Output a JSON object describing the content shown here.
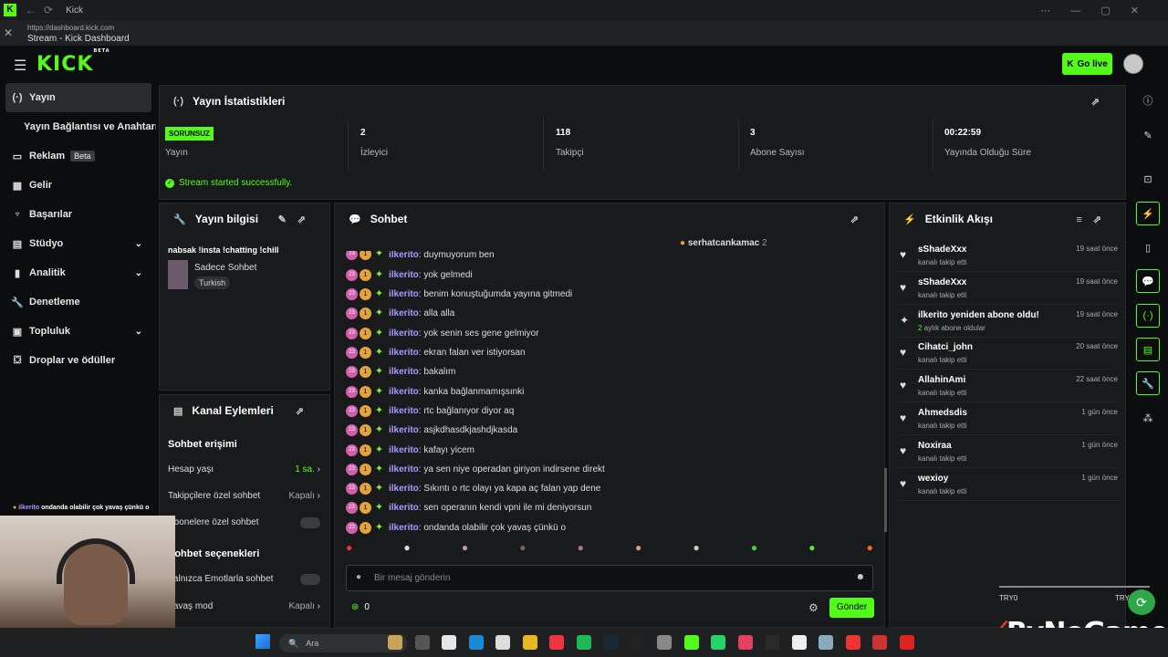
{
  "window": {
    "app_title": "Kick",
    "url": "https://dashboard.kick.com",
    "page_title": "Stream - Kick Dashboard"
  },
  "header": {
    "logo": "KICK",
    "logo_badge": "BETA",
    "go_live": "Go live"
  },
  "sidebar": {
    "items": [
      {
        "label": "Yayın",
        "icon": "broadcast-icon"
      },
      {
        "label": "Yayın Bağlantısı ve Anahtarı",
        "icon": ""
      },
      {
        "label": "Reklam",
        "icon": "ad-icon",
        "badge": "Beta"
      },
      {
        "label": "Gelir",
        "icon": "revenue-icon"
      },
      {
        "label": "Başarılar",
        "icon": "trophy-icon"
      },
      {
        "label": "Stüdyo",
        "icon": "studio-icon"
      },
      {
        "label": "Analitik",
        "icon": "analytics-icon"
      },
      {
        "label": "Denetleme",
        "icon": "wrench-icon"
      },
      {
        "label": "Topluluk",
        "icon": "community-icon"
      },
      {
        "label": "Droplar ve ödüller",
        "icon": "drops-icon"
      }
    ]
  },
  "stats": {
    "title": "Yayın İstatistikleri",
    "status_badge": "SORUNSUZ",
    "status_label": "Yayın",
    "items": [
      {
        "value": "2",
        "label": "İzleyici"
      },
      {
        "value": "118",
        "label": "Takipçi"
      },
      {
        "value": "3",
        "label": "Abone Sayısı"
      },
      {
        "value": "00:22:59",
        "label": "Yayında Olduğu Süre"
      }
    ],
    "success": "Stream started successfully."
  },
  "stream_info": {
    "title": "Yayın bilgisi",
    "stream_title": "nabsak !insta !chatting !chill",
    "category": "Sadece Sohbet",
    "language": "Turkish"
  },
  "channel_actions": {
    "title": "Kanal Eylemleri",
    "section1": "Sohbet erişimi",
    "account_age": "Hesap yaşı",
    "account_age_value": "1 sa.",
    "followers_chat": "Takipçilere özel sohbet",
    "followers_chat_value": "Kapalı",
    "subscribers_chat": "Abonelere özel sohbet",
    "section2": "Sohbet seçenekleri",
    "emote_only": "Yalnızca Emotlarla sohbet",
    "slow_mode": "Yavaş mod",
    "slow_mode_value": "Kapalı"
  },
  "chat": {
    "title": "Sohbet",
    "pinned_user": "serhatcankamac",
    "pinned_count": "2",
    "badge_number": "23",
    "badge_sub": "1",
    "messages": [
      {
        "user": "ilkerito",
        "text": "duymuyorum ben"
      },
      {
        "user": "ilkerito",
        "text": "yok gelmedi"
      },
      {
        "user": "ilkerito",
        "text": "benim konuştuğumda yayına gitmedi"
      },
      {
        "user": "ilkerito",
        "text": "alla alla"
      },
      {
        "user": "ilkerito",
        "text": "yok senin ses gene gelmiyor"
      },
      {
        "user": "ilkerito",
        "text": "ekran falan ver istiyorsan"
      },
      {
        "user": "ilkerito",
        "text": "bakalım"
      },
      {
        "user": "ilkerito",
        "text": "kanka bağlanmamışsınki"
      },
      {
        "user": "ilkerito",
        "text": "rtc bağlanıyor diyor aq"
      },
      {
        "user": "ilkerito",
        "text": "asjkdhasdkjashdjkasda"
      },
      {
        "user": "ilkerito",
        "text": "kafayı yicem"
      },
      {
        "user": "ilkerito",
        "text": "ya sen niye operadan giriyon indirsene direkt"
      },
      {
        "user": "ilkerito",
        "text": "Sıkıntı o rtc olayı ya kapa aç falan yap dene"
      },
      {
        "user": "ilkerito",
        "text": "sen operanın kendi vpni ile mi deniyorsun"
      },
      {
        "user": "ilkerito",
        "text": "ondanda olabilir çok yavaş çünkü o"
      }
    ],
    "input_placeholder": "Bir mesaj gönderin",
    "points": "0",
    "send": "Gönder"
  },
  "events": {
    "title": "Etkinlik Akışı",
    "items": [
      {
        "name": "sShadeXxx",
        "sub": "kanalı takip etti",
        "time": "19 saat önce"
      },
      {
        "name": "sShadeXxx",
        "sub": "kanalı takip etti",
        "time": "19 saat önce"
      },
      {
        "name": "ilkerito yeniden abone oldu!",
        "sub": "aylık abone oldular",
        "sub_count": "2",
        "time": "19 saat önce"
      },
      {
        "name": "Cihatci_john",
        "sub": "kanalı takip etti",
        "time": "20 saat önce"
      },
      {
        "name": "AllahinAmi",
        "sub": "kanalı takip etti",
        "time": "22 saat önce"
      },
      {
        "name": "Ahmedsdis",
        "sub": "kanalı takip etti",
        "time": "1 gün önce"
      },
      {
        "name": "Noxiraa",
        "sub": "kanalı takip etti",
        "time": "1 gün önce"
      },
      {
        "name": "wexioy",
        "sub": "kanalı takip etti",
        "time": "1 gün önce"
      }
    ]
  },
  "overlay": {
    "chat_line_user": "ilkerito",
    "chat_line_text": "ondanda olabilir çok yavaş çünkü o",
    "bynogame": "ByNoGame",
    "try_left": "TRY0",
    "try_right": "TRY"
  },
  "taskbar": {
    "search_placeholder": "Ara"
  },
  "colors": {
    "accent": "#53fc18",
    "panel": "#181a1c",
    "bg": "#0b0d0e",
    "username": "#a99bff"
  }
}
